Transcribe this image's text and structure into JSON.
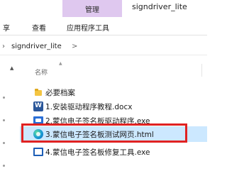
{
  "ribbon": {
    "context_tab": "管理",
    "window_title": "signdriver_lite",
    "tabs": [
      "享",
      "查看",
      "应用程序工具"
    ]
  },
  "address": {
    "path": "signdriver_lite",
    "separator": ">"
  },
  "list": {
    "column_name": "名称",
    "items": [
      {
        "label": "必要档案",
        "icon": "folder-icon"
      },
      {
        "label": "1.安装驱动程序教程.docx",
        "icon": "word-doc-icon"
      },
      {
        "label": "2.蒙信电子签名板驱动程序.exe",
        "icon": "installer-exe-icon"
      },
      {
        "label": "3.蒙信电子签名板测试网页.html",
        "icon": "edge-browser-icon"
      },
      {
        "label": "4.蒙信电子签名板修复工具.exe",
        "icon": "repair-tool-icon"
      }
    ],
    "selected_index": 3
  },
  "colors": {
    "context_tab_bg": "#dfc8ef",
    "selection_bg": "#cce8ff",
    "highlight_border": "#e02222"
  }
}
